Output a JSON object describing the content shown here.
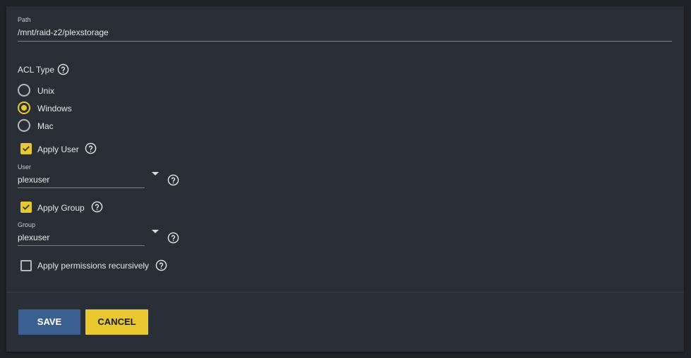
{
  "path": {
    "label": "Path",
    "value": "/mnt/raid-z2/plexstorage"
  },
  "acl": {
    "label": "ACL Type",
    "options": [
      {
        "label": "Unix",
        "checked": false
      },
      {
        "label": "Windows",
        "checked": true
      },
      {
        "label": "Mac",
        "checked": false
      }
    ]
  },
  "apply_user": {
    "label": "Apply User",
    "checked": true
  },
  "user": {
    "label": "User",
    "value": "plexuser"
  },
  "apply_group": {
    "label": "Apply Group",
    "checked": true
  },
  "group": {
    "label": "Group",
    "value": "plexuser"
  },
  "recursive": {
    "label": "Apply permissions recursively",
    "checked": false
  },
  "buttons": {
    "save": "SAVE",
    "cancel": "CANCEL"
  },
  "colors": {
    "accent": "#e8c82e",
    "primary": "#3c5f91",
    "background": "#2a2f37"
  },
  "icons": {
    "help": "help-circle-icon",
    "check": "check-icon",
    "dropdown": "caret-down-icon"
  }
}
